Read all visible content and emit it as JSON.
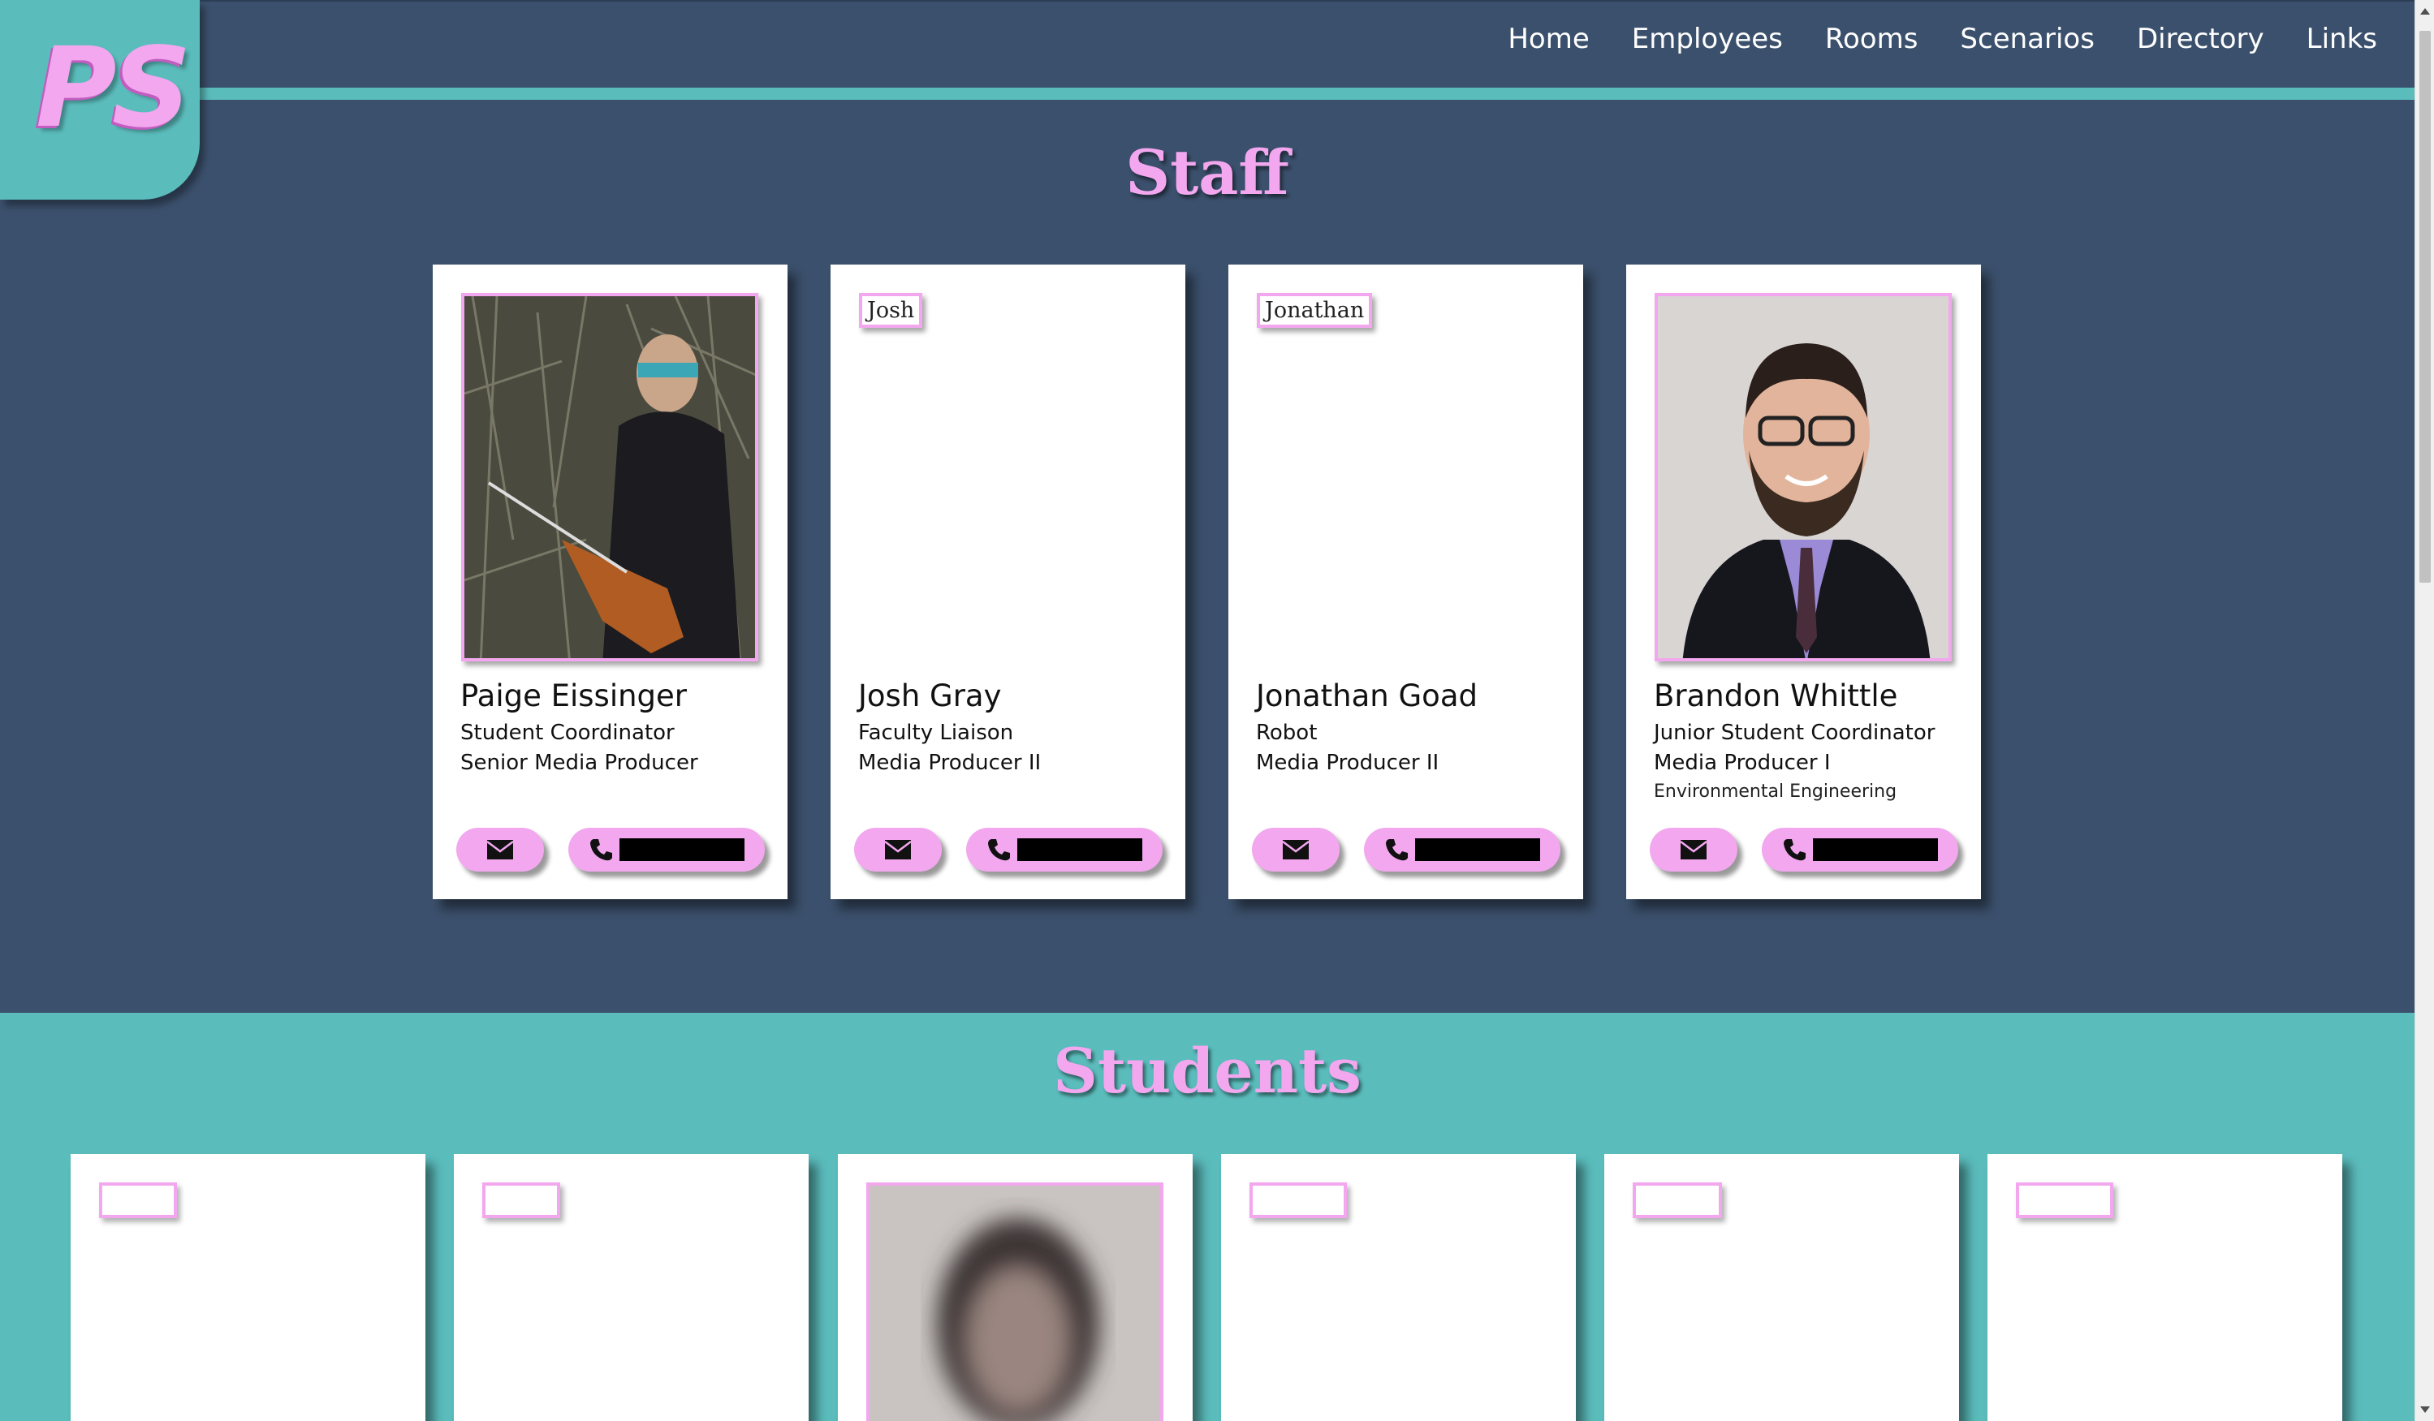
{
  "logo": {
    "text": "PS"
  },
  "nav": {
    "items": [
      "Home",
      "Employees",
      "Rooms",
      "Scenarios",
      "Directory",
      "Links"
    ]
  },
  "staff": {
    "title": "Staff",
    "cards": [
      {
        "name": "Paige Eissinger",
        "role1": "Student Coordinator",
        "role2": "Senior Media Producer",
        "role3": "",
        "photo": "photo"
      },
      {
        "name": "Josh Gray",
        "role1": "Faculty Liaison",
        "role2": "Media Producer II",
        "role3": "",
        "photo_alt": "Josh"
      },
      {
        "name": "Jonathan Goad",
        "role1": "Robot",
        "role2": "Media Producer II",
        "role3": "",
        "photo_alt": "Jonathan"
      },
      {
        "name": "Brandon Whittle",
        "role1": "Junior Student Coordinator",
        "role2": "Media Producer I",
        "role3": "Environmental Engineering",
        "photo": "photo"
      }
    ]
  },
  "students": {
    "title": "Students"
  },
  "colors": {
    "navy": "#3b506c",
    "teal": "#5bbcbc",
    "pink": "#f2a7ee"
  },
  "icons": {
    "email": "envelope-icon",
    "phone": "phone-icon"
  }
}
